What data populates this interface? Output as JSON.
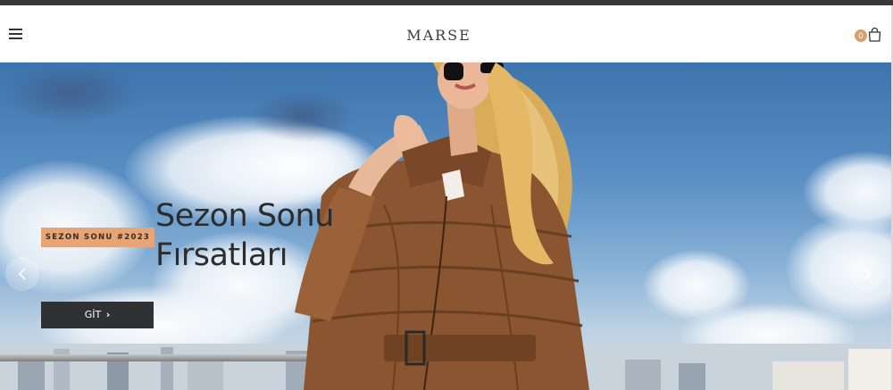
{
  "header": {
    "logo": "MARSE",
    "cart_count": "0"
  },
  "hero": {
    "badge": "SEZON SONU #2023",
    "title_line1": "Sezon Sonu",
    "title_line2": "Fırsatları",
    "cta_label": "GİT"
  },
  "icons": {
    "menu": "hamburger-menu-icon",
    "cart": "shopping-bag-icon",
    "prev": "chevron-left-icon",
    "next": "chevron-right-icon"
  },
  "colors": {
    "accent": "#e6a577",
    "cart_badge": "#d9a06b",
    "button_bg": "#2f3134",
    "text_dark": "#2c2c2c"
  }
}
